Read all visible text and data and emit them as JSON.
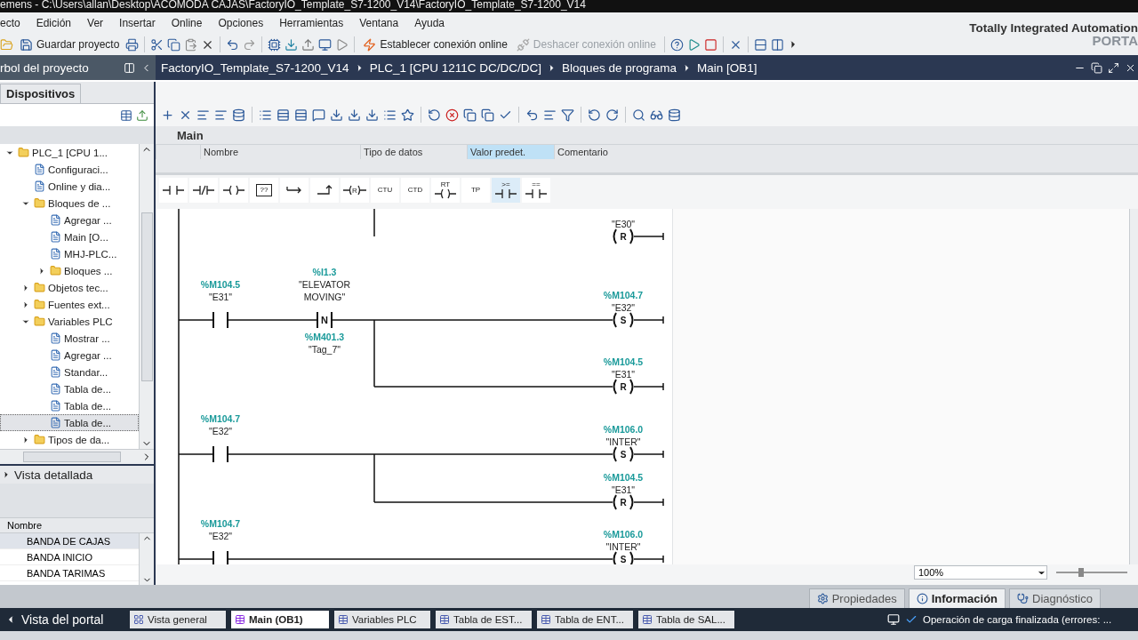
{
  "window": {
    "title": "emens  -  C:\\Users\\allan\\Desktop\\ACOMODA CAJAS\\FactoryIO_Template_S7-1200_V14\\FactoryIO_Template_S7-1200_V14"
  },
  "menu": [
    "ecto",
    "Edición",
    "Ver",
    "Insertar",
    "Online",
    "Opciones",
    "Herramientas",
    "Ventana",
    "Ayuda"
  ],
  "toolbar_buttons": [
    {
      "label": "Guardar proyecto",
      "disabled": false
    },
    {
      "label": "Establecer conexión online",
      "disabled": false
    },
    {
      "label": "Deshacer conexión online",
      "disabled": true
    }
  ],
  "branding": {
    "line_1": "Totally Integrated Automation",
    "line_2": "PORTA"
  },
  "project_tree": {
    "title": "rbol del proyecto",
    "tab": "Dispositivos",
    "items": [
      {
        "label": "PLC_1 [CPU 1...",
        "expanded": true,
        "selected": false,
        "children": [
          {
            "label": "Configuraci...",
            "selected": false
          },
          {
            "label": "Online y dia...",
            "selected": false
          },
          {
            "label": "Bloques de ...",
            "expanded": true,
            "selected": false,
            "children": [
              {
                "label": "Agregar ...",
                "selected": false
              },
              {
                "label": "Main [O...",
                "selected": false
              },
              {
                "label": "MHJ-PLC...",
                "selected": false
              },
              {
                "label": "Bloques ...",
                "expanded": false,
                "selected": false
              }
            ]
          },
          {
            "label": "Objetos tec...",
            "expanded": false,
            "selected": false
          },
          {
            "label": "Fuentes ext...",
            "expanded": false,
            "selected": false
          },
          {
            "label": "Variables PLC",
            "expanded": true,
            "selected": false,
            "children": [
              {
                "label": "Mostrar ...",
                "selected": false
              },
              {
                "label": "Agregar ...",
                "selected": false
              },
              {
                "label": "Standar...",
                "selected": false
              },
              {
                "label": "Tabla de...",
                "selected": false
              },
              {
                "label": "Tabla de...",
                "selected": false
              },
              {
                "label": "Tabla de...",
                "selected": true
              }
            ]
          },
          {
            "label": "Tipos de da...",
            "expanded": false,
            "selected": false
          }
        ]
      }
    ]
  },
  "detail_view": {
    "title": "Vista detallada",
    "column": "Nombre",
    "rows": [
      {
        "name": "BANDA DE CAJAS",
        "selected": true
      },
      {
        "name": "BANDA INICIO",
        "selected": false
      },
      {
        "name": "BANDA TARIMAS",
        "selected": false
      }
    ]
  },
  "breadcrumb": [
    "FactoryIO_Template_S7-1200_V14",
    "PLC_1 [CPU 1211C DC/DC/DC]",
    "Bloques de programa",
    "Main [OB1]"
  ],
  "editor": {
    "block_name": "Main",
    "columns": [
      {
        "label": "Nombre",
        "selected": false
      },
      {
        "label": "Tipo de datos",
        "selected": false
      },
      {
        "label": "Valor predet.",
        "selected": true
      },
      {
        "label": "Comentario",
        "selected": false
      }
    ],
    "palette": [
      {
        "kind": "contact",
        "selected": false
      },
      {
        "kind": "contact_nc",
        "selected": false
      },
      {
        "kind": "coil",
        "selected": false
      },
      {
        "kind": "box",
        "label": "??",
        "selected": false
      },
      {
        "kind": "branch_open",
        "selected": false
      },
      {
        "kind": "branch_close",
        "selected": false
      },
      {
        "kind": "coil",
        "label": "R",
        "selected": false
      },
      {
        "kind": "text",
        "label": "CTU",
        "selected": false
      },
      {
        "kind": "text",
        "label": "CTD",
        "selected": false
      },
      {
        "kind": "timer_coil",
        "label": "RT",
        "selected": false
      },
      {
        "kind": "text",
        "label": "TP",
        "selected": false
      },
      {
        "kind": "contact",
        "label": ">=",
        "selected": true
      },
      {
        "kind": "contact",
        "label": "==",
        "selected": false
      }
    ],
    "networks": [
      {
        "coils": [
          {
            "tag": "\"E30\"",
            "symbol": "R"
          }
        ]
      },
      {
        "contacts": [
          {
            "address": "%M104.5",
            "tag": "\"E31\""
          },
          {
            "address": "%I1.3",
            "tag": "\"ELEVATOR MOVING\"",
            "symbol": "N",
            "below_address": "%M401.3",
            "below_tag": "\"Tag_7\""
          }
        ],
        "coils": [
          {
            "address": "%M104.7",
            "tag": "\"E32\"",
            "symbol": "S"
          },
          {
            "address": "%M104.5",
            "tag": "\"E31\"",
            "symbol": "R"
          }
        ]
      },
      {
        "contacts": [
          {
            "address": "%M104.7",
            "tag": "\"E32\""
          }
        ],
        "coils": [
          {
            "address": "%M106.0",
            "tag": "\"INTER\"",
            "symbol": "S"
          },
          {
            "address": "%M104.5",
            "tag": "\"E31\"",
            "symbol": "R"
          }
        ]
      },
      {
        "contacts": [
          {
            "address": "%M104.7",
            "tag": "\"E32\""
          }
        ],
        "coils": [
          {
            "address": "%M106.0",
            "tag": "\"INTER\"",
            "symbol": "S"
          }
        ]
      }
    ],
    "zoom": "100%",
    "zoom_slider": {
      "level": 0.35
    }
  },
  "inspector_tabs": [
    {
      "label": "Propiedades",
      "selected": false
    },
    {
      "label": "Información",
      "selected": true
    },
    {
      "label": "Diagnóstico",
      "selected": false
    }
  ],
  "taskbar": {
    "portal": "Vista del portal",
    "tabs": [
      {
        "label": "Vista general",
        "selected": false
      },
      {
        "label": "Main (OB1)",
        "selected": true
      },
      {
        "label": "Variables PLC",
        "selected": false
      },
      {
        "label": "Tabla de EST...",
        "selected": false
      },
      {
        "label": "Tabla de ENT...",
        "selected": false
      },
      {
        "label": "Tabla de SAL...",
        "selected": false
      }
    ],
    "status": "Operación de carga finalizada (errores: ..."
  }
}
